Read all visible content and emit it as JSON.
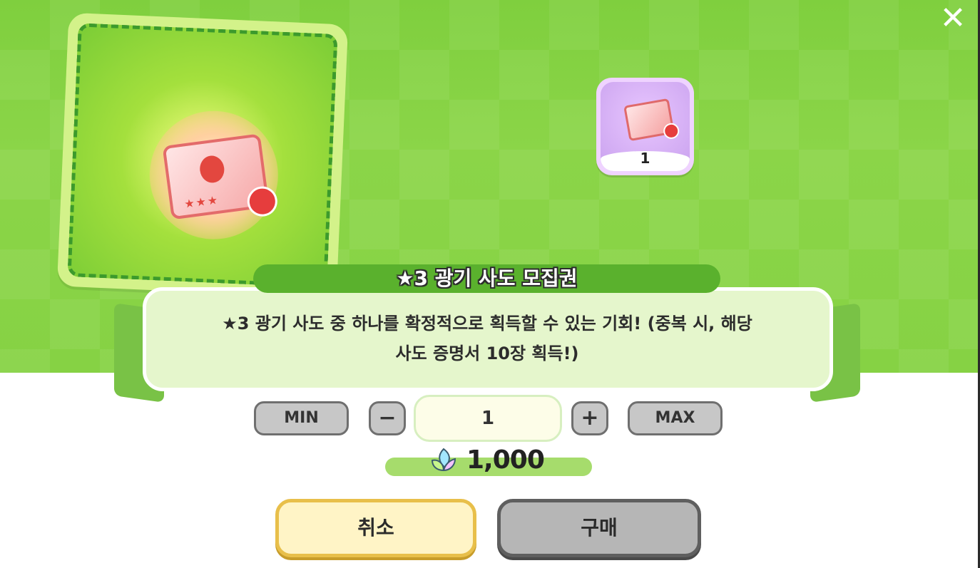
{
  "header": {
    "close_label": "✕"
  },
  "item": {
    "title": "★3 광기 사도 모집권",
    "description_line1": "★3 광기 사도 중 하나를 확정적으로 획득할 수 있는 기회! (중복 시, 해당",
    "description_line2": "사도 증명서 10장 획득!)",
    "owned_count": "1",
    "ticket_stars": "★★★"
  },
  "quantity": {
    "min_label": "MIN",
    "minus_label": "−",
    "value": "1",
    "plus_label": "+",
    "max_label": "MAX"
  },
  "price": {
    "amount": "1,000"
  },
  "actions": {
    "cancel_label": "취소",
    "buy_label": "구매"
  },
  "colors": {
    "header_green": "#86d244",
    "title_green": "#5ab12d",
    "ribbon": "#e5f6cc",
    "cancel": "#fff4c6",
    "buy": "#b6b6b6"
  }
}
